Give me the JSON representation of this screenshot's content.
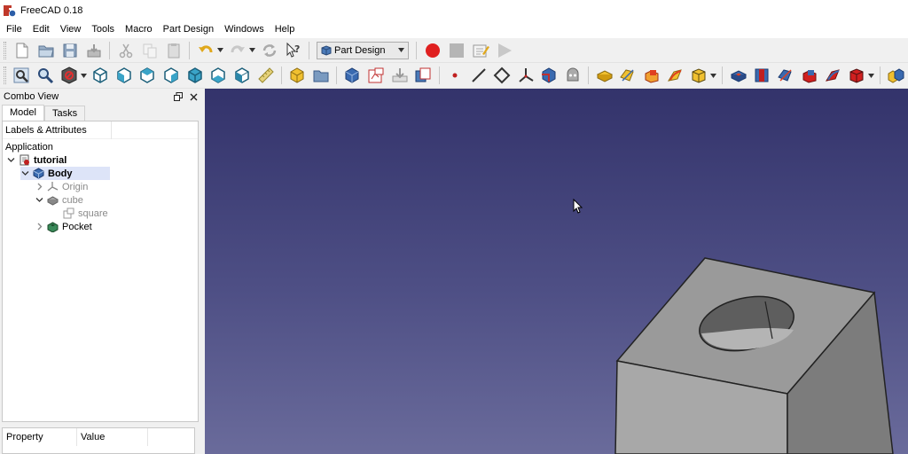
{
  "window": {
    "title": "FreeCAD 0.18"
  },
  "menu": [
    "File",
    "Edit",
    "View",
    "Tools",
    "Macro",
    "Part Design",
    "Windows",
    "Help"
  ],
  "toolbar": {
    "workbench_selected": "Part Design"
  },
  "combo_view": {
    "title": "Combo View",
    "tabs": [
      "Model",
      "Tasks"
    ],
    "active_tab": "Model",
    "tree_header": "Labels & Attributes",
    "tree": [
      {
        "label": "Application",
        "level": 0
      },
      {
        "label": "tutorial",
        "level": 1,
        "expanded": true
      },
      {
        "label": "Body",
        "level": 2,
        "expanded": true,
        "selected": true
      },
      {
        "label": "Origin",
        "level": 3,
        "expanded": false
      },
      {
        "label": "cube",
        "level": 3,
        "expanded": true
      },
      {
        "label": "square",
        "level": 4
      },
      {
        "label": "Pocket",
        "level": 3,
        "expanded": false
      }
    ]
  },
  "property_view": {
    "columns": [
      "Property",
      "Value"
    ]
  },
  "colors": {
    "viewport_top": "#33336b",
    "viewport_bottom": "#6a6b9b",
    "model_face_top": "#9a9a9a",
    "model_face_front": "#a8a8a8",
    "model_face_side": "#7c7c7c",
    "selection": "#dde4f8",
    "record_red": "#e02020"
  }
}
